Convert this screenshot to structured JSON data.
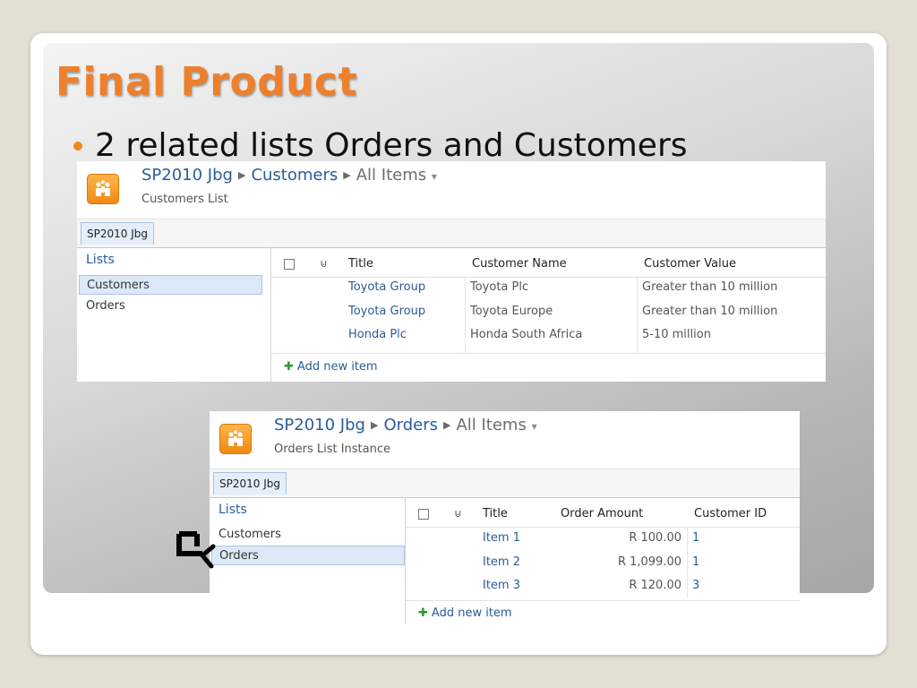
{
  "slide": {
    "title": "Final Product",
    "bullet": "2 related lists Orders and Customers"
  },
  "customers_view": {
    "breadcrumb_site": "SP2010 Jbg",
    "breadcrumb_list": "Customers",
    "breadcrumb_view": "All Items",
    "subtitle": "Customers List",
    "tab": "SP2010 Jbg",
    "nav": {
      "heading": "Lists",
      "items": [
        "Customers",
        "Orders"
      ],
      "selected": "Customers"
    },
    "columns": [
      "Title",
      "Customer Name",
      "Customer Value"
    ],
    "rows": [
      {
        "title": "Toyota Group",
        "customer_name": "Toyota Plc",
        "customer_value": "Greater than 10 million"
      },
      {
        "title": "Toyota Group",
        "customer_name": "Toyota Europe",
        "customer_value": "Greater than 10 million"
      },
      {
        "title": "Honda Plc",
        "customer_name": "Honda South Africa",
        "customer_value": "5-10 million"
      }
    ],
    "add_new": "Add new item"
  },
  "orders_view": {
    "breadcrumb_site": "SP2010 Jbg",
    "breadcrumb_list": "Orders",
    "breadcrumb_view": "All Items",
    "subtitle": "Orders List Instance",
    "tab": "SP2010 Jbg",
    "nav": {
      "heading": "Lists",
      "items": [
        "Customers",
        "Orders"
      ],
      "selected": "Orders"
    },
    "columns": [
      "Title",
      "Order Amount",
      "Customer ID"
    ],
    "rows": [
      {
        "title": "Item 1",
        "order_amount": "R 100.00",
        "customer_id": "1"
      },
      {
        "title": "Item 2",
        "order_amount": "R 1,099.00",
        "customer_id": "1"
      },
      {
        "title": "Item 3",
        "order_amount": "R 120.00",
        "customer_id": "3"
      }
    ],
    "add_new": "Add new item"
  },
  "colors": {
    "title_orange": "#ee7f2c",
    "link_blue": "#2a5c99",
    "selected_bg": "#dbe9f8"
  }
}
